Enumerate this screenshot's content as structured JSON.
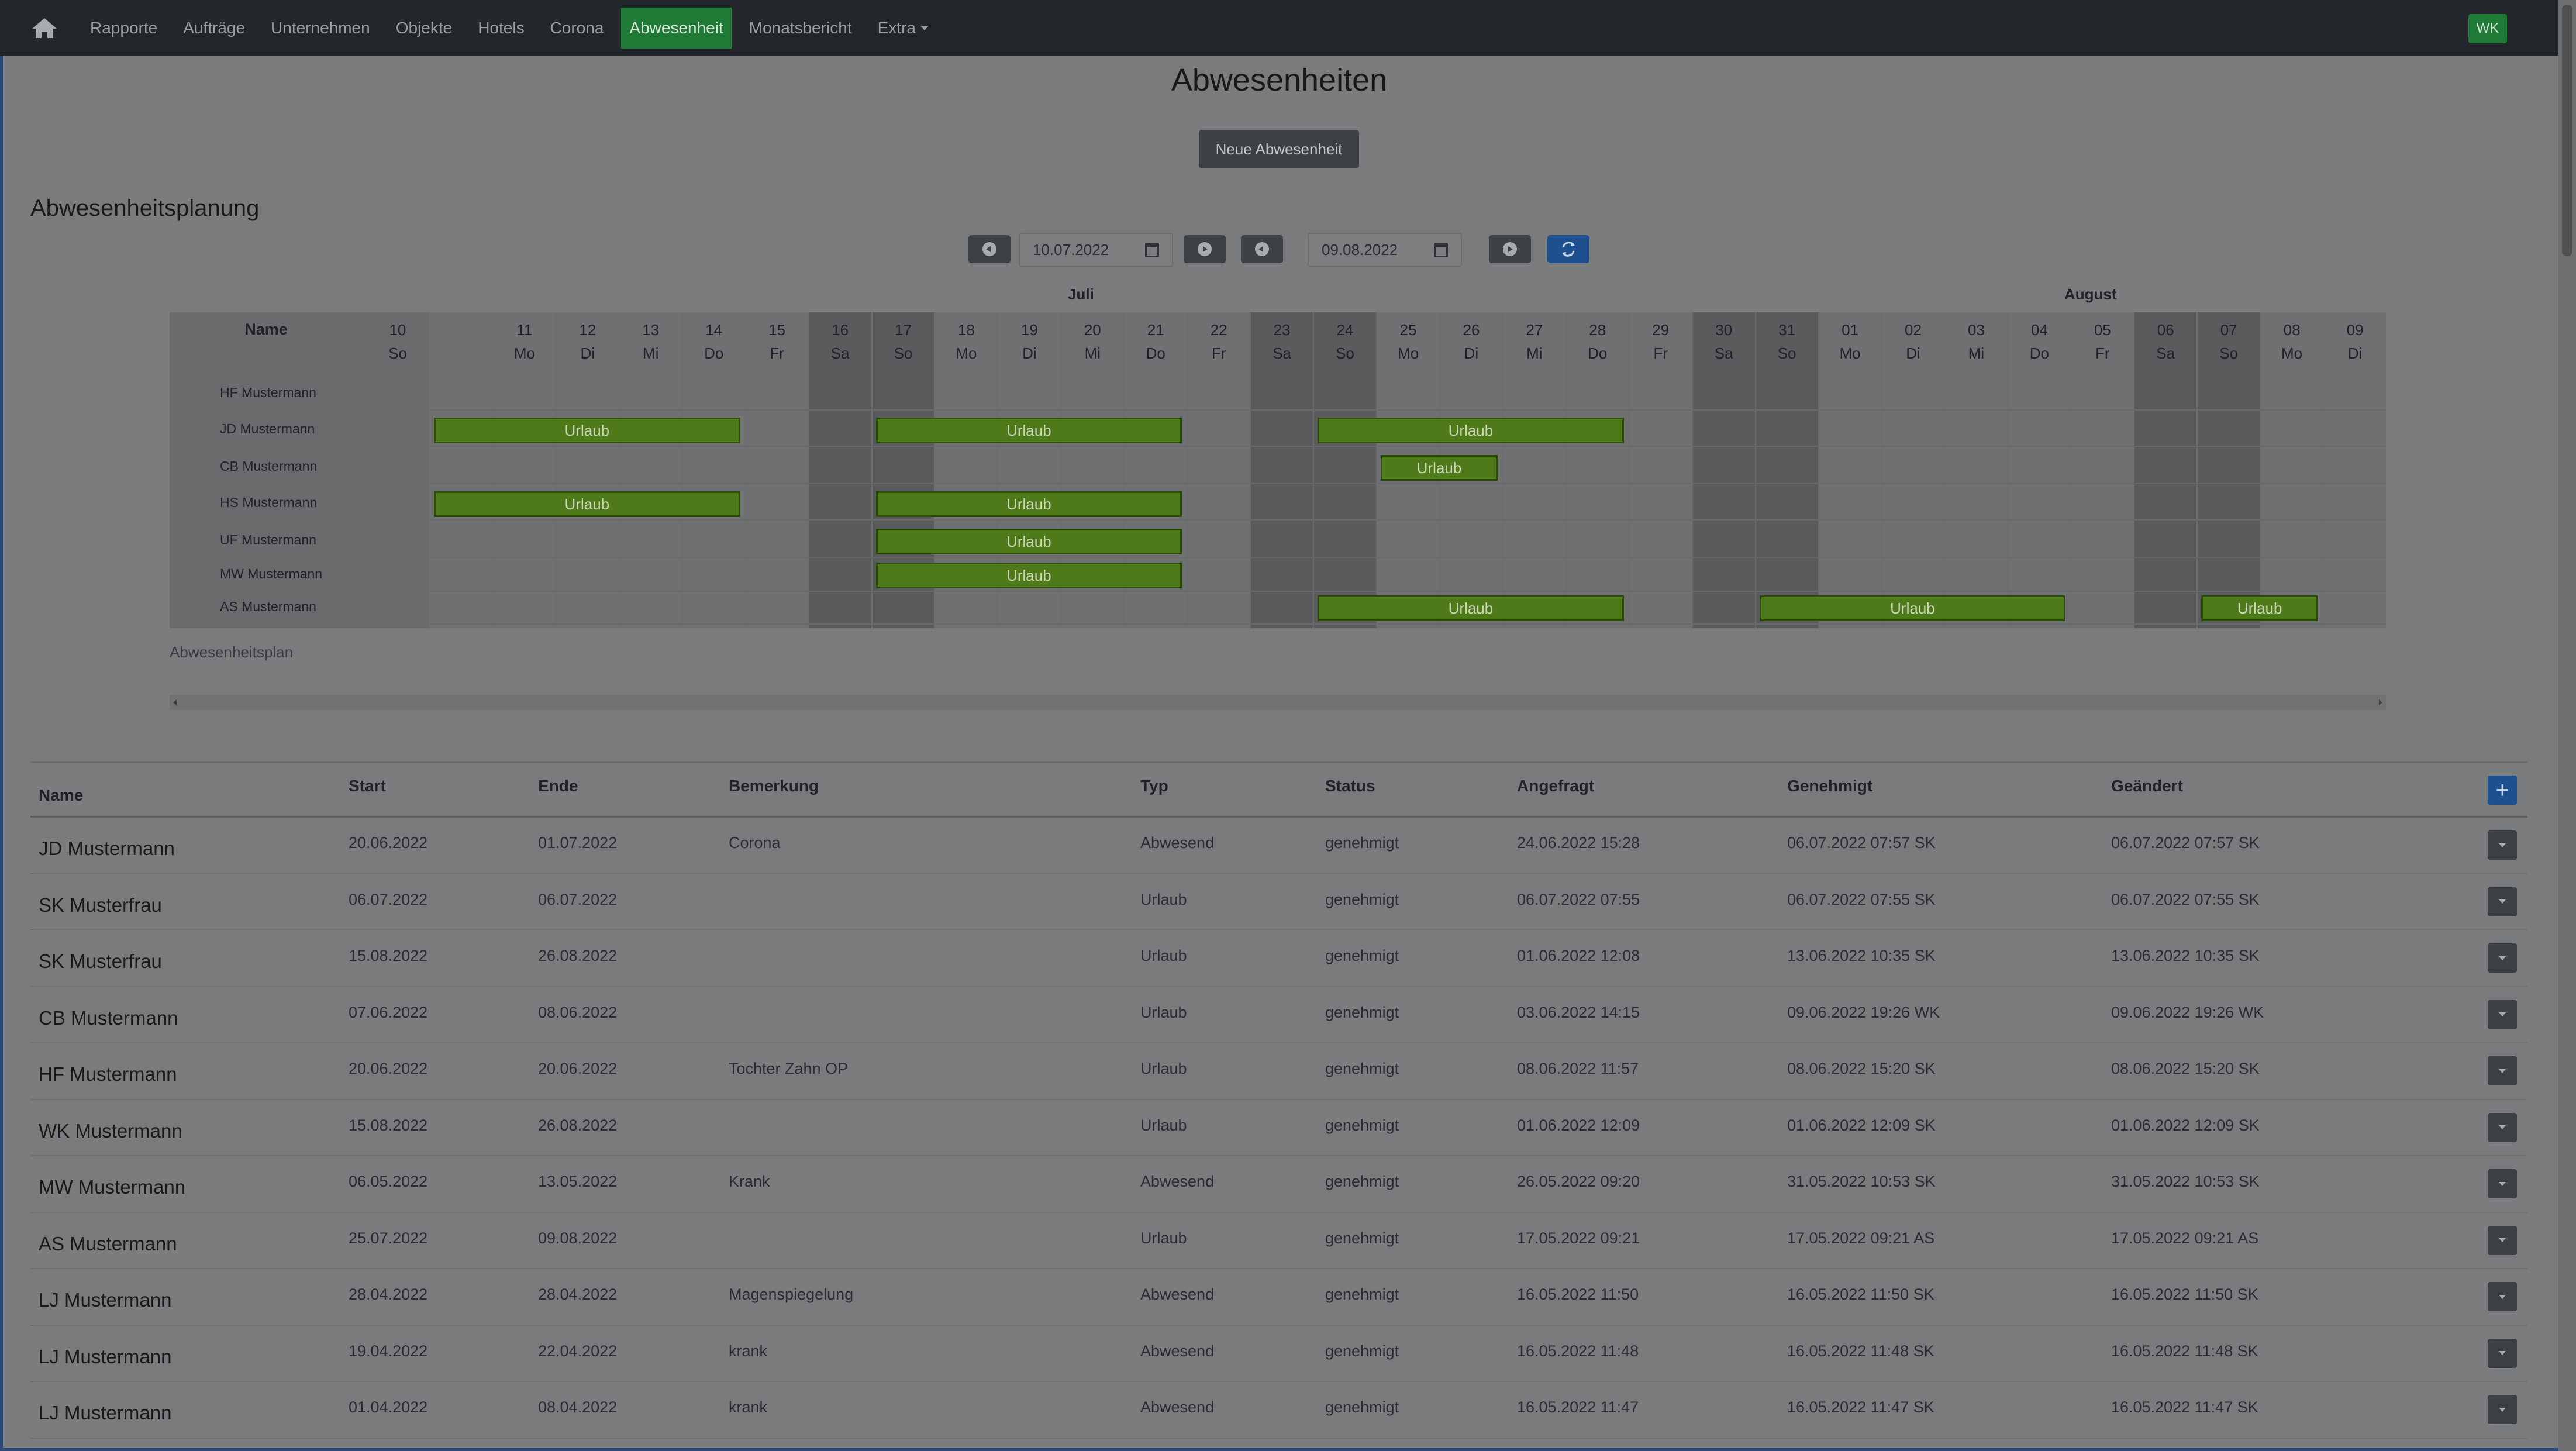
{
  "nav": {
    "items": [
      "Rapporte",
      "Aufträge",
      "Unternehmen",
      "Objekte",
      "Hotels",
      "Corona",
      "Abwesenheit",
      "Monatsbericht",
      "Extra"
    ],
    "active": "Abwesenheit",
    "user_initials": "WK"
  },
  "page": {
    "title": "Abwesenheiten",
    "new_button": "Neue Abwesenheit",
    "section_title": "Abwesenheitsplanung",
    "date_from": "10.07.2022",
    "date_to": "09.08.2022",
    "plan_caption": "Abwesenheitsplan"
  },
  "planner": {
    "name_header": "Name",
    "months": [
      "Juli",
      "August"
    ],
    "days": [
      {
        "d": "10",
        "w": "So"
      },
      {
        "d": "11",
        "w": "Mo"
      },
      {
        "d": "12",
        "w": "Di"
      },
      {
        "d": "13",
        "w": "Mi"
      },
      {
        "d": "14",
        "w": "Do"
      },
      {
        "d": "15",
        "w": "Fr"
      },
      {
        "d": "16",
        "w": "Sa"
      },
      {
        "d": "17",
        "w": "So"
      },
      {
        "d": "18",
        "w": "Mo"
      },
      {
        "d": "19",
        "w": "Di"
      },
      {
        "d": "20",
        "w": "Mi"
      },
      {
        "d": "21",
        "w": "Do"
      },
      {
        "d": "22",
        "w": "Fr"
      },
      {
        "d": "23",
        "w": "Sa"
      },
      {
        "d": "24",
        "w": "So"
      },
      {
        "d": "25",
        "w": "Mo"
      },
      {
        "d": "26",
        "w": "Di"
      },
      {
        "d": "27",
        "w": "Mi"
      },
      {
        "d": "28",
        "w": "Do"
      },
      {
        "d": "29",
        "w": "Fr"
      },
      {
        "d": "30",
        "w": "Sa"
      },
      {
        "d": "31",
        "w": "So"
      },
      {
        "d": "01",
        "w": "Mo"
      },
      {
        "d": "02",
        "w": "Di"
      },
      {
        "d": "03",
        "w": "Mi"
      },
      {
        "d": "04",
        "w": "Do"
      },
      {
        "d": "05",
        "w": "Fr"
      },
      {
        "d": "06",
        "w": "Sa"
      },
      {
        "d": "07",
        "w": "So"
      },
      {
        "d": "08",
        "w": "Mo"
      },
      {
        "d": "09",
        "w": "Di"
      }
    ],
    "rows": [
      {
        "name": "HF Mustermann",
        "bars": []
      },
      {
        "name": "JD Mustermann",
        "bars": [
          {
            "start": 1,
            "end": 5,
            "label": "Urlaub"
          },
          {
            "start": 8,
            "end": 12,
            "label": "Urlaub"
          },
          {
            "start": 15,
            "end": 19,
            "label": "Urlaub"
          }
        ]
      },
      {
        "name": "CB Mustermann",
        "bars": [
          {
            "start": 16,
            "end": 17,
            "label": "Urlaub"
          }
        ]
      },
      {
        "name": "HS Mustermann",
        "bars": [
          {
            "start": 1,
            "end": 5,
            "label": "Urlaub"
          },
          {
            "start": 8,
            "end": 12,
            "label": "Urlaub"
          }
        ]
      },
      {
        "name": "UF Mustermann",
        "bars": [
          {
            "start": 8,
            "end": 12,
            "label": "Urlaub"
          }
        ]
      },
      {
        "name": "MW Mustermann",
        "bars": [
          {
            "start": 8,
            "end": 12,
            "label": "Urlaub"
          }
        ]
      },
      {
        "name": "AS Mustermann",
        "bars": [
          {
            "start": 15,
            "end": 19,
            "label": "Urlaub"
          },
          {
            "start": 22,
            "end": 26,
            "label": "Urlaub"
          },
          {
            "start": 29,
            "end": 30,
            "label": "Urlaub"
          }
        ]
      }
    ]
  },
  "table": {
    "headers": [
      "Name",
      "Start",
      "Ende",
      "Bemerkung",
      "Typ",
      "Status",
      "Angefragt",
      "Genehmigt",
      "Geändert"
    ],
    "rows": [
      [
        "JD Mustermann",
        "20.06.2022",
        "01.07.2022",
        "Corona",
        "Abwesend",
        "genehmigt",
        "24.06.2022 15:28",
        "06.07.2022 07:57 SK",
        "06.07.2022 07:57 SK"
      ],
      [
        "SK Musterfrau",
        "06.07.2022",
        "06.07.2022",
        "",
        "Urlaub",
        "genehmigt",
        "06.07.2022 07:55",
        "06.07.2022 07:55 SK",
        "06.07.2022 07:55 SK"
      ],
      [
        "SK Musterfrau",
        "15.08.2022",
        "26.08.2022",
        "",
        "Urlaub",
        "genehmigt",
        "01.06.2022 12:08",
        "13.06.2022 10:35 SK",
        "13.06.2022 10:35 SK"
      ],
      [
        "CB Mustermann",
        "07.06.2022",
        "08.06.2022",
        "",
        "Urlaub",
        "genehmigt",
        "03.06.2022 14:15",
        "09.06.2022 19:26 WK",
        "09.06.2022 19:26 WK"
      ],
      [
        "HF Mustermann",
        "20.06.2022",
        "20.06.2022",
        "Tochter Zahn OP",
        "Urlaub",
        "genehmigt",
        "08.06.2022 11:57",
        "08.06.2022 15:20 SK",
        "08.06.2022 15:20 SK"
      ],
      [
        "WK Mustermann",
        "15.08.2022",
        "26.08.2022",
        "",
        "Urlaub",
        "genehmigt",
        "01.06.2022 12:09",
        "01.06.2022 12:09 SK",
        "01.06.2022 12:09 SK"
      ],
      [
        "MW Mustermann",
        "06.05.2022",
        "13.05.2022",
        "Krank",
        "Abwesend",
        "genehmigt",
        "26.05.2022 09:20",
        "31.05.2022 10:53 SK",
        "31.05.2022 10:53 SK"
      ],
      [
        "AS Mustermann",
        "25.07.2022",
        "09.08.2022",
        "",
        "Urlaub",
        "genehmigt",
        "17.05.2022 09:21",
        "17.05.2022 09:21 AS",
        "17.05.2022 09:21 AS"
      ],
      [
        "LJ Mustermann",
        "28.04.2022",
        "28.04.2022",
        "Magenspiegelung",
        "Abwesend",
        "genehmigt",
        "16.05.2022 11:50",
        "16.05.2022 11:50 SK",
        "16.05.2022 11:50 SK"
      ],
      [
        "LJ Mustermann",
        "19.04.2022",
        "22.04.2022",
        "krank",
        "Abwesend",
        "genehmigt",
        "16.05.2022 11:48",
        "16.05.2022 11:48 SK",
        "16.05.2022 11:48 SK"
      ],
      [
        "LJ Mustermann",
        "01.04.2022",
        "08.04.2022",
        "krank",
        "Abwesend",
        "genehmigt",
        "16.05.2022 11:47",
        "16.05.2022 11:47 SK",
        "16.05.2022 11:47 SK"
      ]
    ]
  }
}
